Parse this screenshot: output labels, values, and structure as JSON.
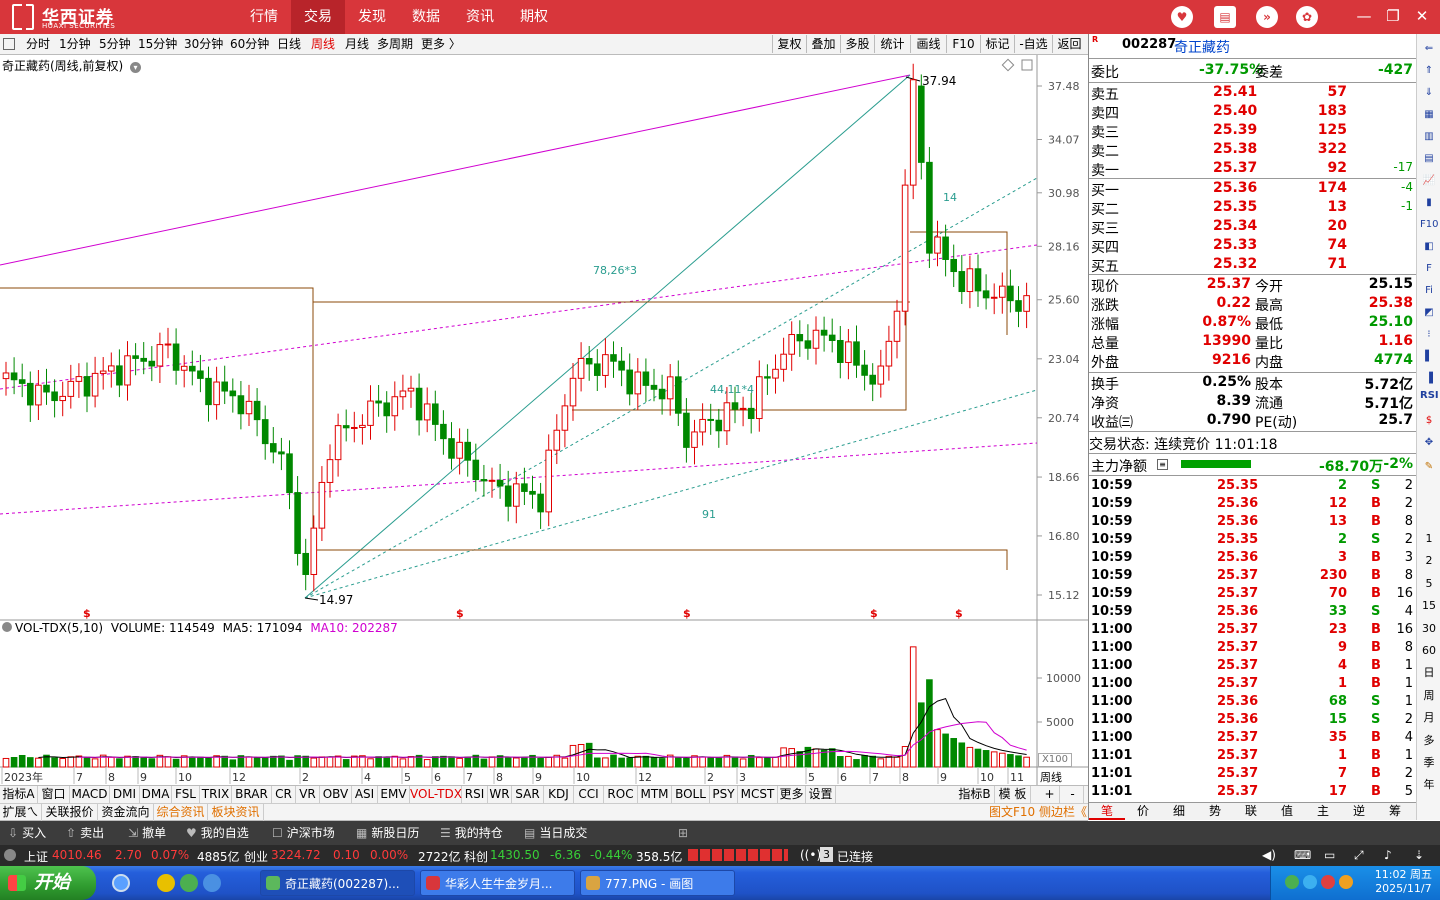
{
  "topbar": {
    "logo_cn": "华西证券",
    "logo_en": "HUAXI SECURITIES",
    "tabs": [
      "行情",
      "交易",
      "发现",
      "数据",
      "资讯",
      "期权"
    ],
    "active_tab": "交易"
  },
  "periodbar": {
    "periods": [
      "分时",
      "1分钟",
      "5分钟",
      "15分钟",
      "30分钟",
      "60分钟",
      "日线",
      "周线",
      "月线",
      "多周期",
      "更多 〉"
    ],
    "active_period": "周线",
    "tools": [
      "复权",
      "叠加",
      "多股",
      "统计",
      "画线",
      "F10",
      "标记",
      "-自选",
      "返回"
    ]
  },
  "chart": {
    "title": "奇正藏药(周线,前复权)",
    "price_axis": [
      "37.48",
      "34.07",
      "30.98",
      "28.16",
      "25.60",
      "23.04",
      "20.74",
      "18.66",
      "16.80",
      "15.12"
    ],
    "high_label": "37.94",
    "low_label": "14.97",
    "annotations": [
      "78,26*3",
      "44,11*4",
      "14",
      "91"
    ],
    "dollar_marker": "$",
    "vol_legend": {
      "name": "VOL-TDX(5,10)",
      "volume": "VOLUME: 114549",
      "ma5": "MA5: 171094",
      "ma10": "MA10: 202287"
    },
    "vol_axis": [
      "10000",
      "5000"
    ],
    "vol_unit": "X100",
    "x_axis": [
      "2023年",
      "7",
      "8",
      "9",
      "10",
      "12",
      "2",
      "4",
      "5",
      "6",
      "7",
      "8",
      "9",
      "10",
      "12",
      "2",
      "3",
      "5",
      "6",
      "7",
      "8",
      "9",
      "10",
      "11"
    ],
    "period_label": "周线"
  },
  "indicator_tabs": [
    "指标A",
    "窗口",
    "MACD",
    "DMI",
    "DMA",
    "FSL",
    "TRIX",
    "BRAR",
    "CR",
    "VR",
    "OBV",
    "ASI",
    "EMV",
    "VOL-TDX",
    "RSI",
    "WR",
    "SAR",
    "KDJ",
    "CCI",
    "ROC",
    "MTM",
    "BOLL",
    "PSY",
    "MCST",
    "更多",
    "设置"
  ],
  "indicator_active": "VOL-TDX",
  "indicator_right": [
    "指标B",
    "模 板",
    "+",
    "-"
  ],
  "info_tabs": [
    "扩展ㄟ",
    "关联报价",
    "资金流向",
    "综合资讯",
    "板块资讯"
  ],
  "info_right": "图文F10 侧边栏《",
  "quote": {
    "badge": "R",
    "code": "002287",
    "name": "奇正藏药",
    "weibi_label": "委比",
    "weibi": "-37.75%",
    "weicha_label": "委差",
    "weicha": "-427",
    "asks": [
      {
        "label": "卖五",
        "price": "25.41",
        "vol": "57",
        "chg": ""
      },
      {
        "label": "卖四",
        "price": "25.40",
        "vol": "183",
        "chg": ""
      },
      {
        "label": "卖三",
        "price": "25.39",
        "vol": "125",
        "chg": ""
      },
      {
        "label": "卖二",
        "price": "25.38",
        "vol": "322",
        "chg": ""
      },
      {
        "label": "卖一",
        "price": "25.37",
        "vol": "92",
        "chg": "-17"
      }
    ],
    "bids": [
      {
        "label": "买一",
        "price": "25.36",
        "vol": "174",
        "chg": "-4"
      },
      {
        "label": "买二",
        "price": "25.35",
        "vol": "13",
        "chg": "-1"
      },
      {
        "label": "买三",
        "price": "25.34",
        "vol": "20",
        "chg": ""
      },
      {
        "label": "买四",
        "price": "25.33",
        "vol": "74",
        "chg": ""
      },
      {
        "label": "买五",
        "price": "25.32",
        "vol": "71",
        "chg": ""
      }
    ],
    "stats": [
      {
        "l1": "现价",
        "v1": "25.37",
        "c1": "red",
        "l2": "今开",
        "v2": "25.15",
        "c2": "black"
      },
      {
        "l1": "涨跌",
        "v1": "0.22",
        "c1": "red",
        "l2": "最高",
        "v2": "25.38",
        "c2": "red"
      },
      {
        "l1": "涨幅",
        "v1": "0.87%",
        "c1": "red",
        "l2": "最低",
        "v2": "25.10",
        "c2": "green"
      },
      {
        "l1": "总量",
        "v1": "13990",
        "c1": "red",
        "l2": "量比",
        "v2": "1.16",
        "c2": "red"
      },
      {
        "l1": "外盘",
        "v1": "9216",
        "c1": "red",
        "l2": "内盘",
        "v2": "4774",
        "c2": "green"
      },
      {
        "l1": "换手",
        "v1": "0.25%",
        "c1": "black",
        "l2": "股本",
        "v2": "5.72亿",
        "c2": "black"
      },
      {
        "l1": "净资",
        "v1": "8.39",
        "c1": "black",
        "l2": "流通",
        "v2": "5.71亿",
        "c2": "black"
      },
      {
        "l1": "收益㈢",
        "v1": "0.790",
        "c1": "black",
        "l2": "PE(动)",
        "v2": "25.7",
        "c2": "black"
      }
    ],
    "trade_status": "交易状态: 连续竞价 11:01:18",
    "netflow_label": "主力净额",
    "netflow_value": "-68.70万",
    "netflow_pct": "-2%",
    "netflow_fill": 0.7
  },
  "ticks": [
    {
      "t": "10:59",
      "p": "25.35",
      "v": "2",
      "s": "S",
      "n": "2"
    },
    {
      "t": "10:59",
      "p": "25.36",
      "v": "12",
      "s": "B",
      "n": "2"
    },
    {
      "t": "10:59",
      "p": "25.36",
      "v": "13",
      "s": "B",
      "n": "8"
    },
    {
      "t": "10:59",
      "p": "25.35",
      "v": "2",
      "s": "S",
      "n": "2"
    },
    {
      "t": "10:59",
      "p": "25.36",
      "v": "3",
      "s": "B",
      "n": "3"
    },
    {
      "t": "10:59",
      "p": "25.37",
      "v": "230",
      "s": "B",
      "n": "8"
    },
    {
      "t": "10:59",
      "p": "25.37",
      "v": "70",
      "s": "B",
      "n": "16"
    },
    {
      "t": "10:59",
      "p": "25.36",
      "v": "33",
      "s": "S",
      "n": "4"
    },
    {
      "t": "11:00",
      "p": "25.37",
      "v": "23",
      "s": "B",
      "n": "16"
    },
    {
      "t": "11:00",
      "p": "25.37",
      "v": "9",
      "s": "B",
      "n": "8"
    },
    {
      "t": "11:00",
      "p": "25.37",
      "v": "4",
      "s": "B",
      "n": "1"
    },
    {
      "t": "11:00",
      "p": "25.37",
      "v": "1",
      "s": "B",
      "n": "1"
    },
    {
      "t": "11:00",
      "p": "25.36",
      "v": "68",
      "s": "S",
      "n": "1"
    },
    {
      "t": "11:00",
      "p": "25.36",
      "v": "15",
      "s": "S",
      "n": "2"
    },
    {
      "t": "11:00",
      "p": "25.37",
      "v": "35",
      "s": "B",
      "n": "4"
    },
    {
      "t": "11:01",
      "p": "25.37",
      "v": "1",
      "s": "B",
      "n": "1"
    },
    {
      "t": "11:01",
      "p": "25.37",
      "v": "7",
      "s": "B",
      "n": "2"
    },
    {
      "t": "11:01",
      "p": "25.37",
      "v": "17",
      "s": "B",
      "n": "5"
    }
  ],
  "right_tabs": [
    "笔",
    "价",
    "细",
    "势",
    "联",
    "值",
    "主",
    "逆",
    "筹"
  ],
  "right_tab_active": "笔",
  "right_toolbar": [
    "RSI",
    "1",
    "2",
    "5",
    "15",
    "30",
    "60",
    "日",
    "周",
    "月",
    "多",
    "季",
    "年"
  ],
  "funcbar": [
    "买入",
    "卖出",
    "撤单",
    "我的自选",
    "沪深市场",
    "新股日历",
    "我的持仓",
    "当日成交"
  ],
  "market": {
    "sh_label": "上证",
    "sh_val": "4010.46",
    "sh_chg": "2.70",
    "sh_pct": "0.07%",
    "sh_amt": "4885亿",
    "cy_label": "创业",
    "cy_val": "3224.72",
    "cy_chg": "0.10",
    "cy_pct": "0.00%",
    "cy_amt": "2722亿",
    "kc_label": "科创",
    "kc_val": "1430.50",
    "kc_chg": "-6.36",
    "kc_pct": "-0.44%",
    "kc_amt": "358.5亿",
    "conn_count": "3",
    "conn_text": "已连接"
  },
  "taskbar": {
    "start": "开始",
    "tasks": [
      "奇正藏药(002287)...",
      "华彩人生牛金岁月...",
      "777.PNG - 画图"
    ],
    "time": "11:02 周五",
    "date": "2025/11/7"
  }
}
